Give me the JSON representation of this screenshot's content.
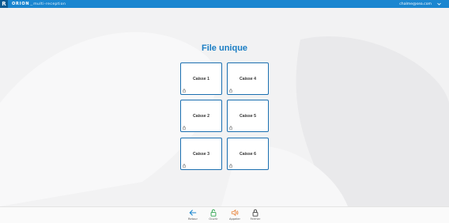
{
  "header": {
    "logo_letter": "R",
    "brand": "ORION",
    "separator": "_",
    "app_name": "multi-reception",
    "user_email": "chalme@sea.com"
  },
  "main": {
    "title": "File unique",
    "registers": [
      {
        "label": "Caisse 1"
      },
      {
        "label": "Caisse 4"
      },
      {
        "label": "Caisse 2"
      },
      {
        "label": "Caisse 5"
      },
      {
        "label": "Caisse 3"
      },
      {
        "label": "Caisse 6"
      }
    ]
  },
  "actions": [
    {
      "label": "Retour",
      "icon": "arrow-left-icon",
      "color": "#1a86d0"
    },
    {
      "label": "Ouvrir",
      "icon": "lock-open-icon",
      "color": "#2ea44f"
    },
    {
      "label": "Appeler",
      "icon": "speaker-icon",
      "color": "#e8833a"
    },
    {
      "label": "Fermer",
      "icon": "lock-icon",
      "color": "#444444"
    }
  ],
  "colors": {
    "header": "#1a86d0",
    "accent": "#1a7dc4",
    "card_border": "#1b6fb0"
  }
}
